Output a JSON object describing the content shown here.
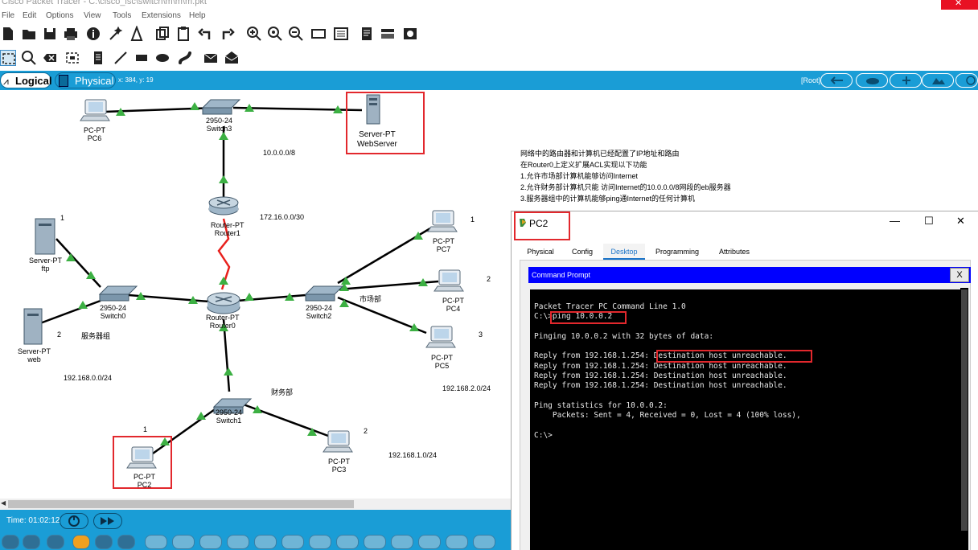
{
  "app": {
    "title": "Cisco Packet Tracer - C:\\cisco_lsc\\switch\\m\\m\\m.pkt",
    "close_glyph": "✕"
  },
  "menu": [
    "File",
    "Edit",
    "Options",
    "View",
    "Tools",
    "Extensions",
    "Help"
  ],
  "toolbar1_icons": [
    "new-icon",
    "open-icon",
    "save-icon",
    "print-icon",
    "info-icon",
    "wizard-icon",
    "network-info-icon",
    "copy-icon",
    "paste-icon",
    "undo-icon",
    "redo-icon",
    "zoom-in-icon",
    "zoom-reset-icon",
    "zoom-out-icon",
    "drawing-palette-icon",
    "custom-devices-icon",
    "notes-icon",
    "viewport-icon",
    "screenshot-icon"
  ],
  "toolbar2_icons": [
    "select-icon",
    "inspect-icon",
    "delete-icon",
    "resize-icon",
    "note-icon",
    "line-icon",
    "rectangle-icon",
    "ellipse-icon",
    "freeform-icon",
    "add-pdu-icon",
    "add-complex-pdu-icon"
  ],
  "viewbar": {
    "logical": "Logical",
    "physical": "Physical",
    "coords": "x: 384, y: 19",
    "root": "[Root]"
  },
  "devices": {
    "pc6": {
      "type": "PC-PT",
      "name": "PC6"
    },
    "switch3": {
      "type": "2950-24",
      "name": "Switch3"
    },
    "webserver": {
      "type": "Server-PT",
      "name": "WebServer"
    },
    "router1": {
      "type": "Router-PT",
      "name": "Router1"
    },
    "ftp": {
      "type": "Server-PT",
      "name": "ftp"
    },
    "web": {
      "type": "Server-PT",
      "name": "web"
    },
    "switch0": {
      "type": "2950-24",
      "name": "Switch0"
    },
    "router0": {
      "type": "Router-PT",
      "name": "Router0"
    },
    "switch2": {
      "type": "2950-24",
      "name": "Switch2"
    },
    "pc7": {
      "type": "PC-PT",
      "name": "PC7"
    },
    "pc4": {
      "type": "PC-PT",
      "name": "PC4"
    },
    "pc5": {
      "type": "PC-PT",
      "name": "PC5"
    },
    "switch1": {
      "type": "2950-24",
      "name": "Switch1"
    },
    "pc2": {
      "type": "PC-PT",
      "name": "PC2"
    },
    "pc3": {
      "type": "PC-PT",
      "name": "PC3"
    }
  },
  "labels": {
    "net_10": "10.0.0.0/8",
    "net_172": "172.16.0.0/30",
    "net_168_0": "192.168.0.0/24",
    "net_168_2": "192.168.2.0/24",
    "net_168_1": "192.168.1.0/24",
    "server_group": "服务器组",
    "market_dept": "市场部",
    "finance_dept": "财务部",
    "num_ftp": "1",
    "num_web": "2",
    "num_pc7": "1",
    "num_pc4": "2",
    "num_pc5": "3",
    "num_pc2": "1",
    "num_pc3": "2"
  },
  "note_lines": [
    "网络中的路由器和计算机已经配置了IP地址和路由",
    "在Router0上定义扩展ACL实现以下功能",
    "1.允许市场部计算机能够访问Internet",
    "2.允许财务部计算机只能 访问Internet的10.0.0.0/8网段的eb服务器",
    "3.服务器组中的计算机能够ping通Internet的任何计算机"
  ],
  "time": "Time: 01:02:12",
  "pc_window": {
    "title": "PC2",
    "minimize": "—",
    "maximize": "☐",
    "close": "✕",
    "tabs": [
      "Physical",
      "Config",
      "Desktop",
      "Programming",
      "Attributes"
    ],
    "active_tab": "Desktop",
    "cmd_title": "Command Prompt",
    "cmd_close": "X",
    "terminal": [
      "Packet Tracer PC Command Line 1.0",
      "C:\\>ping 10.0.0.2",
      "",
      "Pinging 10.0.0.2 with 32 bytes of data:",
      "",
      "Reply from 192.168.1.254: Destination host unreachable.",
      "Reply from 192.168.1.254: Destination host unreachable.",
      "Reply from 192.168.1.254: Destination host unreachable.",
      "Reply from 192.168.1.254: Destination host unreachable.",
      "",
      "Ping statistics for 10.0.0.2:",
      "    Packets: Sent = 4, Received = 0, Lost = 4 (100% loss),",
      "",
      "C:\\>"
    ]
  },
  "colors": {
    "accent": "#1a9dd6",
    "link": "#000000",
    "serial_link": "#e8201c",
    "port_up": "#3cb043",
    "highlight": "#e2282d"
  }
}
